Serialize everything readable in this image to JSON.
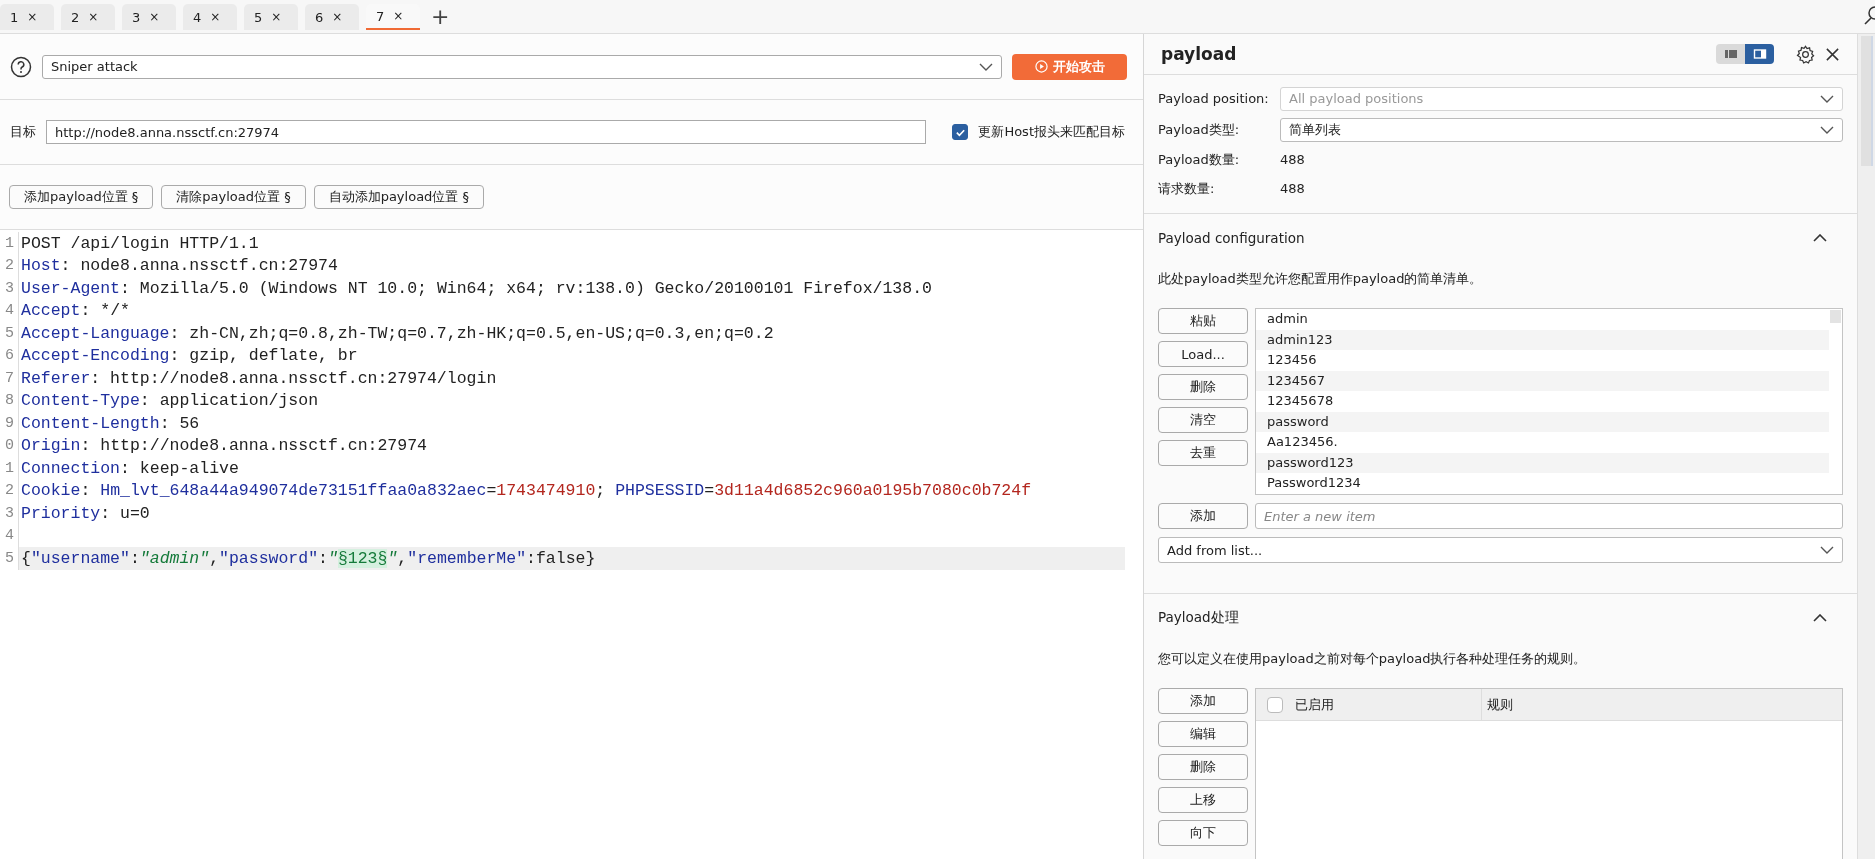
{
  "tabs": [
    {
      "label": "1",
      "close": "×",
      "selected": false
    },
    {
      "label": "2",
      "close": "×",
      "selected": false
    },
    {
      "label": "3",
      "close": "×",
      "selected": false
    },
    {
      "label": "4",
      "close": "×",
      "selected": false
    },
    {
      "label": "5",
      "close": "×",
      "selected": false
    },
    {
      "label": "6",
      "close": "×",
      "selected": false
    },
    {
      "label": "7",
      "close": "×",
      "selected": true
    }
  ],
  "add_tab": "+",
  "attack": {
    "type": "Sniper attack",
    "start_button": "开始攻击"
  },
  "target": {
    "label": "目标",
    "value": "http://node8.anna.nssctf.cn:27974",
    "update_host": {
      "label": "更新Host报头来匹配目标",
      "checked": true
    }
  },
  "position_buttons": [
    "添加payload位置 §",
    "清除payload位置 §",
    "自动添加payload位置 §"
  ],
  "editor": {
    "lines": [
      {
        "number": "1",
        "current": false,
        "segments": [
          {
            "kind": "text",
            "text": "POST /api/login HTTP/1.1"
          }
        ]
      },
      {
        "number": "2",
        "current": false,
        "segments": [
          {
            "kind": "name",
            "text": "Host"
          },
          {
            "kind": "text",
            "text": ": node8.anna.nssctf.cn:27974"
          }
        ]
      },
      {
        "number": "3",
        "current": false,
        "segments": [
          {
            "kind": "name",
            "text": "User-Agent"
          },
          {
            "kind": "text",
            "text": ": Mozilla/5.0 (Windows NT 10.0; Win64; x64; rv:138.0) Gecko/20100101 Firefox/138.0"
          }
        ]
      },
      {
        "number": "4",
        "current": false,
        "segments": [
          {
            "kind": "name",
            "text": "Accept"
          },
          {
            "kind": "text",
            "text": ": */*"
          }
        ]
      },
      {
        "number": "5",
        "current": false,
        "segments": [
          {
            "kind": "name",
            "text": "Accept-Language"
          },
          {
            "kind": "text",
            "text": ": zh-CN,zh;q=0.8,zh-TW;q=0.7,zh-HK;q=0.5,en-US;q=0.3,en;q=0.2"
          }
        ]
      },
      {
        "number": "6",
        "current": false,
        "segments": [
          {
            "kind": "name",
            "text": "Accept-Encoding"
          },
          {
            "kind": "text",
            "text": ": gzip, deflate, br"
          }
        ]
      },
      {
        "number": "7",
        "current": false,
        "segments": [
          {
            "kind": "name",
            "text": "Referer"
          },
          {
            "kind": "text",
            "text": ": http://node8.anna.nssctf.cn:27974/login"
          }
        ]
      },
      {
        "number": "8",
        "current": false,
        "segments": [
          {
            "kind": "name",
            "text": "Content-Type"
          },
          {
            "kind": "text",
            "text": ": application/json"
          }
        ]
      },
      {
        "number": "9",
        "current": false,
        "segments": [
          {
            "kind": "name",
            "text": "Content-Length"
          },
          {
            "kind": "text",
            "text": ": 56"
          }
        ]
      },
      {
        "number": "0",
        "current": false,
        "segments": [
          {
            "kind": "name",
            "text": "Origin"
          },
          {
            "kind": "text",
            "text": ": http://node8.anna.nssctf.cn:27974"
          }
        ]
      },
      {
        "number": "1",
        "current": false,
        "segments": [
          {
            "kind": "name",
            "text": "Connection"
          },
          {
            "kind": "text",
            "text": ": keep-alive"
          }
        ]
      },
      {
        "number": "2",
        "current": false,
        "segments": [
          {
            "kind": "name",
            "text": "Cookie"
          },
          {
            "kind": "text",
            "text": ": "
          },
          {
            "kind": "name",
            "text": "Hm_lvt_648a44a949074de73151ffaa0a832aec"
          },
          {
            "kind": "text",
            "text": "="
          },
          {
            "kind": "value",
            "text": "1743474910"
          },
          {
            "kind": "text",
            "text": "; "
          },
          {
            "kind": "name",
            "text": "PHPSESSID"
          },
          {
            "kind": "text",
            "text": "="
          },
          {
            "kind": "value",
            "text": "3d11a4d6852c960a0195b7080c0b724f"
          }
        ]
      },
      {
        "number": "3",
        "current": false,
        "segments": [
          {
            "kind": "name",
            "text": "Priority"
          },
          {
            "kind": "text",
            "text": ": u=0"
          }
        ]
      },
      {
        "number": "4",
        "current": false
      },
      {
        "number": "5",
        "current": true,
        "segments": [
          {
            "kind": "text",
            "text": "{"
          },
          {
            "kind": "key",
            "text": "\"username\""
          },
          {
            "kind": "text",
            "text": ":"
          },
          {
            "kind": "string",
            "text": "\"admin\""
          },
          {
            "kind": "text",
            "text": ","
          },
          {
            "kind": "key",
            "text": "\"password\""
          },
          {
            "kind": "text",
            "text": ":"
          },
          {
            "kind": "string",
            "text": "\""
          },
          {
            "kind": "marker",
            "text": "§123§"
          },
          {
            "kind": "string",
            "text": "\""
          },
          {
            "kind": "text",
            "text": ","
          },
          {
            "kind": "key",
            "text": "\"rememberMe\""
          },
          {
            "kind": "text",
            "text": ":false}"
          }
        ]
      }
    ]
  },
  "panel": {
    "title": "payload",
    "layout_toggle": [
      {
        "selected": false
      },
      {
        "selected": true
      }
    ],
    "selects": [
      {
        "label": "Payload position:",
        "value": "All payload positions",
        "disabled": true
      },
      {
        "label": "Payload类型:",
        "value": "简单列表",
        "disabled": false
      }
    ],
    "counts": [
      {
        "label": "Payload数量:",
        "value": "488"
      },
      {
        "label": "请求数量:",
        "value": "488"
      }
    ],
    "configuration": {
      "title": "Payload configuration",
      "expanded": true,
      "description": "此处payload类型允许您配置用作payload的简单清单。",
      "buttons": [
        "粘贴",
        "Load...",
        "删除",
        "清空",
        "去重"
      ],
      "items": [
        "admin",
        "admin123",
        "123456",
        "1234567",
        "12345678",
        "password",
        "Aa123456.",
        "password123",
        "Password1234"
      ],
      "add_button": "添加",
      "new_item_placeholder": "Enter a new item",
      "add_from_list": "Add from list..."
    },
    "processing": {
      "title": "Payload处理",
      "expanded": true,
      "description": "您可以定义在使用payload之前对每个payload执行各种处理任务的规则。",
      "buttons": [
        "添加",
        "编辑",
        "删除",
        "上移",
        "向下"
      ],
      "select_all_checked": false,
      "columns": [
        "已启用",
        "规则"
      ]
    }
  }
}
